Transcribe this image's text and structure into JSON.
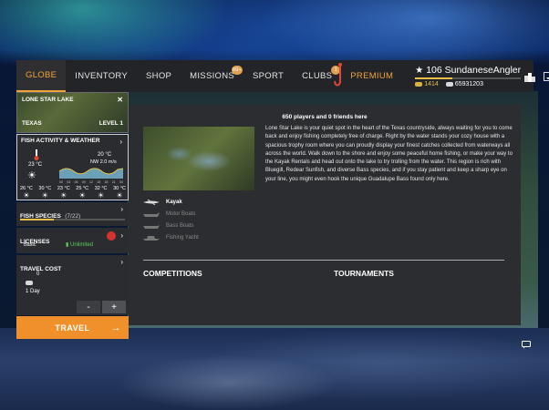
{
  "nav": {
    "tabs": [
      {
        "label": "GLOBE",
        "active": true
      },
      {
        "label": "INVENTORY"
      },
      {
        "label": "SHOP"
      },
      {
        "label": "MISSIONS",
        "badge": "99+"
      },
      {
        "label": "SPORT"
      },
      {
        "label": "CLUBS",
        "badge": "1"
      },
      {
        "label": "PREMIUM"
      }
    ]
  },
  "player": {
    "level": "106",
    "name": "SundaneseAngler",
    "gold": "1414",
    "silver": "65931203"
  },
  "icons": [
    "star-icon",
    "gold-coin-icon",
    "silver-coin-icon",
    "clubhouse-icon",
    "boat-icon",
    "gear-icon",
    "chat-icon",
    "thermometer-icon",
    "sun-icon",
    "kayak-icon"
  ],
  "lake": {
    "name": "LONE STAR LAKE",
    "state": "TEXAS",
    "level": "LEVEL 1"
  },
  "fish_activity": {
    "title": "FISH ACTIVITY & WEATHER",
    "current_temp": "23 °C",
    "water_temp": "20 °C",
    "wind": "NW 2.0 m/s",
    "hours": [
      "00",
      "03",
      "06",
      "09",
      "12",
      "15",
      "18",
      "21",
      "00"
    ],
    "days": [
      {
        "temp": "26 °C",
        "icon": "sun"
      },
      {
        "temp": "30 °C",
        "icon": "sun"
      },
      {
        "temp": "23 °C",
        "icon": "sun"
      },
      {
        "temp": "25 °C",
        "icon": "sun"
      },
      {
        "temp": "32 °C",
        "icon": "sun"
      },
      {
        "temp": "30 °C",
        "icon": "sun"
      }
    ]
  },
  "fish_species": {
    "title": "FISH SPECIES",
    "count": "(7/22)"
  },
  "licenses": {
    "title": "LICENSES",
    "type": "Basic",
    "status": "Unlimited"
  },
  "travel_cost": {
    "title": "TRAVEL COST",
    "cost": "0",
    "days": "1 Day",
    "minus": "-",
    "plus": "+"
  },
  "travel_button": "TRAVEL",
  "main": {
    "players_line": "650 players and 0 friends here",
    "description": "Lone Star Lake is your quiet spot in the heart of the Texas countryside, always waiting for you to come back and enjoy fishing completely free of charge. Right by the water stands your cozy house with a spacious trophy room where you can proudly display your finest catches collected from waterways all across the world. Walk down to the shore and enjoy some peaceful home fishing, or make your way to the Kayak Rentals and head out onto the lake to try trolling from the water. This region is rich with Bluegill, Redear Sunfish, and diverse Bass species, and if you stay patient and keep a sharp eye on your line, you might even hook the unique Guadalupe Bass found only here.",
    "boats": [
      {
        "label": "Kayak",
        "available": true
      },
      {
        "label": "Motor Boats",
        "available": false
      },
      {
        "label": "Bass Boats",
        "available": false
      },
      {
        "label": "Fishing Yacht",
        "available": false
      }
    ],
    "competitions": "COMPETITIONS",
    "tournaments": "TOURNAMENTS"
  },
  "colors": {
    "accent": "#f0902a",
    "panel": "#2b2d30",
    "topbar": "#222428",
    "gold": "#e6c04a"
  }
}
